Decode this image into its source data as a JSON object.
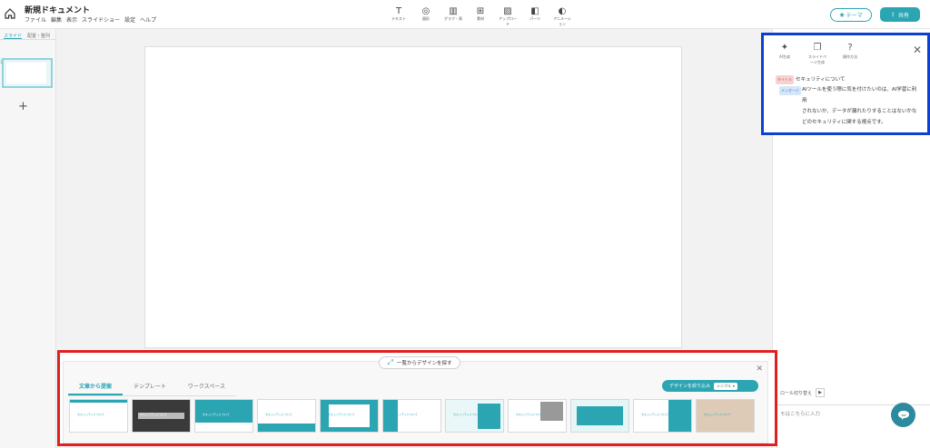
{
  "header": {
    "doc_title": "新規ドキュメント",
    "menu": [
      "ファイル",
      "編集",
      "表示",
      "スライドショー",
      "設定",
      "ヘルプ"
    ],
    "tools": [
      {
        "label": "テキスト",
        "icon": "text-icon"
      },
      {
        "label": "図形",
        "icon": "shapes-icon"
      },
      {
        "label": "グラフ・表",
        "icon": "chart-icon"
      },
      {
        "label": "素材",
        "icon": "assets-icon"
      },
      {
        "label": "アップロード",
        "icon": "upload-icon"
      },
      {
        "label": "パーツ",
        "icon": "parts-icon"
      },
      {
        "label": "アニメーション",
        "icon": "animation-icon"
      }
    ],
    "theme_label": "テーマ",
    "share_label": "共有"
  },
  "left_panel": {
    "tabs": [
      "スライド",
      "配置・整列"
    ],
    "slide_number": "1"
  },
  "ai_panel": {
    "tools": [
      {
        "label": "AI生成",
        "icon": "sparkle-icon"
      },
      {
        "label": "スライドページ生成",
        "icon": "pages-icon"
      },
      {
        "label": "操作方法",
        "icon": "help-icon"
      }
    ],
    "title_tag": "タイトル",
    "title_text": "セキュリティについて",
    "message_tag": "メッセージ",
    "body_lines": [
      "AIツールを使う際に気を付けたいのは、AI学習に利用",
      "されないか、データが漏れたりすることはないかな",
      "どのセキュリティに関する視点です。"
    ]
  },
  "role_switch_label": "ロール切り替え",
  "memo_placeholder": "モはこちらに入力",
  "design_panel": {
    "find_button": "一覧からデザインを探す",
    "tabs": [
      "文章から提案",
      "テンプレート",
      "ワークスペース"
    ],
    "narrow_button": "デザインを絞り込み",
    "narrow_select": "シンプル",
    "thumb_caption": "セキュリティについて",
    "thumbs": [
      {
        "bg": "#ffffff",
        "accent": "#2ca5b3",
        "dark": false
      },
      {
        "bg": "#3a3a3a",
        "accent": "#bbbbbb",
        "dark": true
      },
      {
        "bg": "#2ca5b3",
        "accent": "#ffffff",
        "dark": true
      },
      {
        "bg": "#ffffff",
        "accent": "#2ca5b3",
        "dark": false
      },
      {
        "bg": "#2ca5b3",
        "accent": "#ffffff",
        "dark": false
      },
      {
        "bg": "#ffffff",
        "accent": "#2ca5b3",
        "dark": false
      },
      {
        "bg": "#eaf7f8",
        "accent": "#2ca5b3",
        "dark": false
      },
      {
        "bg": "#ffffff",
        "accent": "#999999",
        "dark": false
      },
      {
        "bg": "#e6f6f7",
        "accent": "#2ca5b3",
        "dark": false
      },
      {
        "bg": "#2ca5b3",
        "accent": "#ffffff",
        "dark": false
      },
      {
        "bg": "#f2ece6",
        "accent": "#c7a98a",
        "dark": false
      }
    ]
  }
}
